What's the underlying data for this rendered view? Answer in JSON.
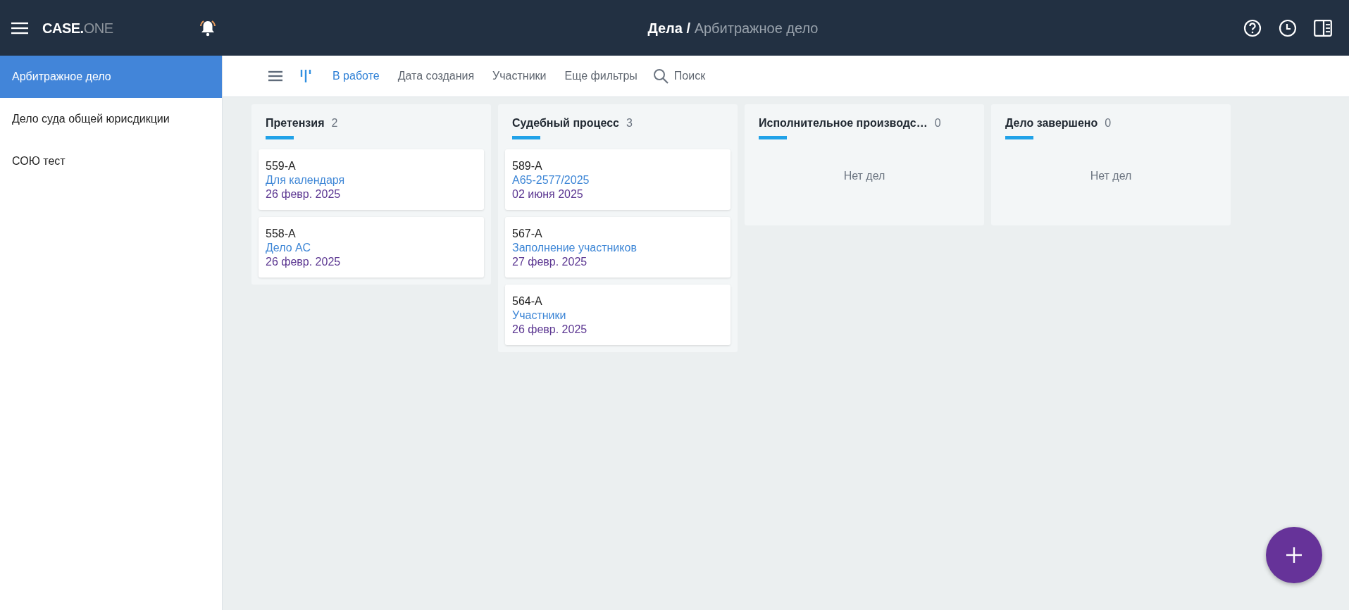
{
  "header": {
    "logo_main": "CASE.",
    "logo_accent": "ONE",
    "breadcrumb_root": "Дела /",
    "breadcrumb_current": "Арбитражное дело"
  },
  "sidebar": {
    "items": [
      {
        "label": "Арбитражное дело",
        "selected": true
      },
      {
        "label": "Дело суда общей юрисдикции",
        "selected": false
      },
      {
        "label": "СОЮ тест",
        "selected": false
      }
    ]
  },
  "toolbar": {
    "view_modes": [
      {
        "kind": "list",
        "selected": false
      },
      {
        "kind": "board",
        "selected": true
      }
    ],
    "filters": [
      {
        "label": "В работе",
        "selected": true
      },
      {
        "label": "Дата создания",
        "selected": false
      },
      {
        "label": "Участники",
        "selected": false
      },
      {
        "label": "Еще фильтры",
        "selected": false
      }
    ],
    "search": {
      "placeholder": "Поиск"
    }
  },
  "columns": [
    {
      "title": "Претензия",
      "count": "2",
      "cards": [
        {
          "number": "559-А",
          "title": "Для календаря",
          "date": "26 февр. 2025"
        },
        {
          "number": "558-А",
          "title": "Дело АС",
          "date": "26 февр. 2025"
        }
      ]
    },
    {
      "title": "Судебный процесс",
      "count": "3",
      "cards": [
        {
          "number": "589-А",
          "title": "А65-2577/2025",
          "date": "02 июня 2025"
        },
        {
          "number": "567-А",
          "title": "Заполнение участников",
          "date": "27 февр. 2025"
        },
        {
          "number": "564-А",
          "title": "Участники",
          "date": "26 февр. 2025"
        }
      ]
    },
    {
      "title": "Исполнительное производс…",
      "count": "0",
      "empty_text": "Нет дел"
    },
    {
      "title": "Дело завершено",
      "count": "0",
      "empty_text": "Нет дел"
    }
  ]
}
